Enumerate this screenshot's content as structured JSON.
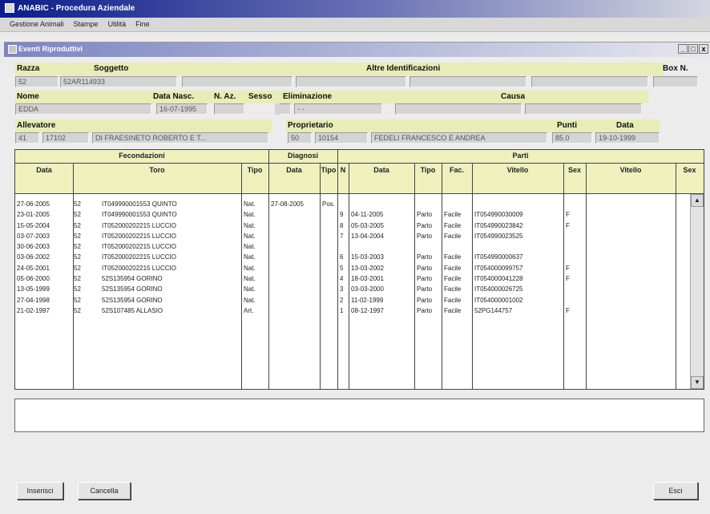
{
  "app": {
    "title": "ANABIC - Procedura Aziendale"
  },
  "menu": [
    "Gestione Animali",
    "Stampe",
    "Utilità",
    "Fine"
  ],
  "window": {
    "title": "Eventi Riproduttivi",
    "controls": [
      "_",
      "□",
      "x"
    ]
  },
  "form": {
    "razza": {
      "label": "Razza",
      "value": "52"
    },
    "soggetto": {
      "label": "Soggetto",
      "value": "52AR114933"
    },
    "altre": {
      "label": "Altre Identificazioni",
      "values": [
        "",
        "",
        "",
        "",
        ""
      ]
    },
    "box": {
      "label": "Box N.",
      "value": ""
    },
    "nome": {
      "label": "Nome",
      "value": "EDDA"
    },
    "data_nasc": {
      "label": "Data Nasc.",
      "value": "16-07-1995"
    },
    "n_az": {
      "label": "N. Az.",
      "value": ""
    },
    "sesso": {
      "label": "Sesso",
      "value": ""
    },
    "eliminazione": {
      "label": "Eliminazione",
      "value": "- -"
    },
    "causa": {
      "label": "Causa",
      "values": [
        "",
        ""
      ]
    },
    "allevatore": {
      "label": "Allevatore",
      "code1": "41",
      "code2": "17102",
      "name": "DI FRAESINETO ROBERTO E T..."
    },
    "proprietario": {
      "label": "Proprietario",
      "code1": "50",
      "code2": "10154",
      "name": "FEDELI FRANCESCO E ANDREA"
    },
    "punti": {
      "label": "Punti",
      "value": "85.0"
    },
    "data": {
      "label": "Data",
      "value": "19-10-1999"
    }
  },
  "grid": {
    "group_headers": [
      "Fecondazioni",
      "Diagnosi",
      "Parti"
    ],
    "columns": [
      "Data",
      "Toro",
      "Tipo",
      "Data",
      "Tipo",
      "N",
      "Data",
      "Tipo",
      "Fac.",
      "Vitello",
      "Sex",
      "Vitello",
      "Sex"
    ],
    "rows": [
      [
        "27-06-2005",
        "52",
        "IT049990001553 QUINTO",
        "Nat.",
        "27-08-2005",
        "Pos.",
        "",
        "",
        "",
        "",
        "",
        ""
      ],
      [
        "23-01-2005",
        "52",
        "IT049990001553 QUINTO",
        "Nat.",
        "",
        "",
        "9",
        "04-11-2005",
        "Parto",
        "Facile",
        "IT054990030009",
        "F"
      ],
      [
        "15-05-2004",
        "52",
        "IT052000202215 LUCCIO",
        "Nat.",
        "",
        "",
        "8",
        "05-03-2005",
        "Parto",
        "Facile",
        "IT054990023842",
        "F"
      ],
      [
        "03-07-2003",
        "52",
        "IT052000202215 LUCCIO",
        "Nat.",
        "",
        "",
        "7",
        "13-04-2004",
        "Parto",
        "Facile",
        "IT054990023525",
        ""
      ],
      [
        "30-06-2003",
        "52",
        "IT052000202215 LUCCIO",
        "Nat.",
        "",
        "",
        "",
        "",
        "",
        "",
        "",
        ""
      ],
      [
        "03-06-2002",
        "52",
        "IT052000202215 LUCCIO",
        "Nat.",
        "",
        "",
        "6",
        "15-03-2003",
        "Parto",
        "Facile",
        "IT054990000637",
        ""
      ],
      [
        "24-05-2001",
        "52",
        "IT052000202215 LUCCIO",
        "Nat.",
        "",
        "",
        "5",
        "13-03-2002",
        "Parto",
        "Facile",
        "IT054000099757",
        "F"
      ],
      [
        "05-06-2000",
        "52",
        "52S135954      GORINO",
        "Nat.",
        "",
        "",
        "4",
        "18-03-2001",
        "Parto",
        "Facile",
        "IT054000041228",
        "F"
      ],
      [
        "13-05-1999",
        "52",
        "52S135954      GORINO",
        "Nat.",
        "",
        "",
        "3",
        "03-03-2000",
        "Parto",
        "Facile",
        "IT054000026725",
        ""
      ],
      [
        "27-04-1998",
        "52",
        "52S135954      GORINO",
        "Nat.",
        "",
        "",
        "2",
        "11-02-1999",
        "Parto",
        "Facile",
        "IT054000001002",
        ""
      ],
      [
        "21-02-1997",
        "52",
        "52S107485      ALLASIO",
        "Art.",
        "",
        "",
        "1",
        "08-12-1997",
        "Parto",
        "Facile",
        "52PG144757",
        "F"
      ]
    ]
  },
  "buttons": {
    "inserisci": "Inserisci",
    "cancella": "Cancella",
    "esci": "Esci"
  },
  "colors": {
    "header_fill": "#eff1bd",
    "label_fill": "#e8ecb6",
    "titlebar": "#0b1d8a"
  }
}
